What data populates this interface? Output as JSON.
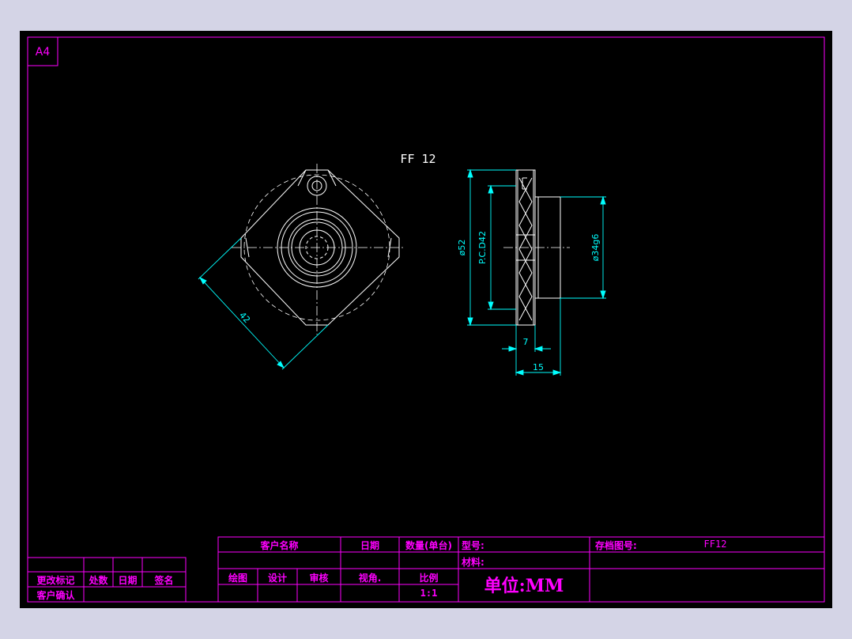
{
  "sheet": {
    "size_label": "A4",
    "part_title": "FF 12"
  },
  "dimensions": {
    "diag_42": "42",
    "dia_52": "ø52",
    "pcd_42": "P.C.D42",
    "dia_34g6": "ø34g6",
    "width_7": "7",
    "width_15": "15"
  },
  "title_block": {
    "customer_name": "客户名称",
    "date": "日期",
    "quantity": "数量(单台)",
    "model": "型号:",
    "archive_no": "存档图号:",
    "archive_value": "FF12",
    "material": "材料:",
    "drawn": "绘图",
    "designed": "设计",
    "checked": "审核",
    "view_angle": "视角.",
    "scale_label": "比例",
    "scale_value": "1:1",
    "unit": "单位:MM"
  },
  "revision_block": {
    "change_mark": "更改标记",
    "count": "处数",
    "date": "日期",
    "signature": "签名",
    "customer_confirm": "客户确认"
  },
  "colors": {
    "background": "#000000",
    "frame": "#ff00ff",
    "geometry": "#ffffff",
    "dimension": "#00ffff"
  }
}
